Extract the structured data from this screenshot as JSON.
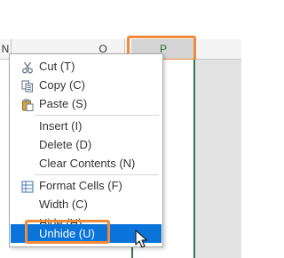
{
  "columns": {
    "n_label": "N",
    "o_label": "O",
    "p_label": "P"
  },
  "context_menu": {
    "items": [
      {
        "label": "Cut (T)",
        "icon": "scissors-icon"
      },
      {
        "label": "Copy (C)",
        "icon": "copy-icon"
      },
      {
        "label": "Paste (S)",
        "icon": "clipboard-icon"
      },
      {
        "label": "Insert (I)"
      },
      {
        "label": "Delete (D)"
      },
      {
        "label": "Clear Contents (N)"
      },
      {
        "label": "Format Cells (F)",
        "icon": "format-cells-icon"
      },
      {
        "label": "Width (C)"
      },
      {
        "label": "Hide (H)"
      },
      {
        "label": "Unhide (U)",
        "selected": true
      }
    ]
  },
  "colors": {
    "selection_blue": "#0a74da",
    "highlight_orange": "#f08a3c",
    "gridline_green": "#2f7a4a"
  }
}
